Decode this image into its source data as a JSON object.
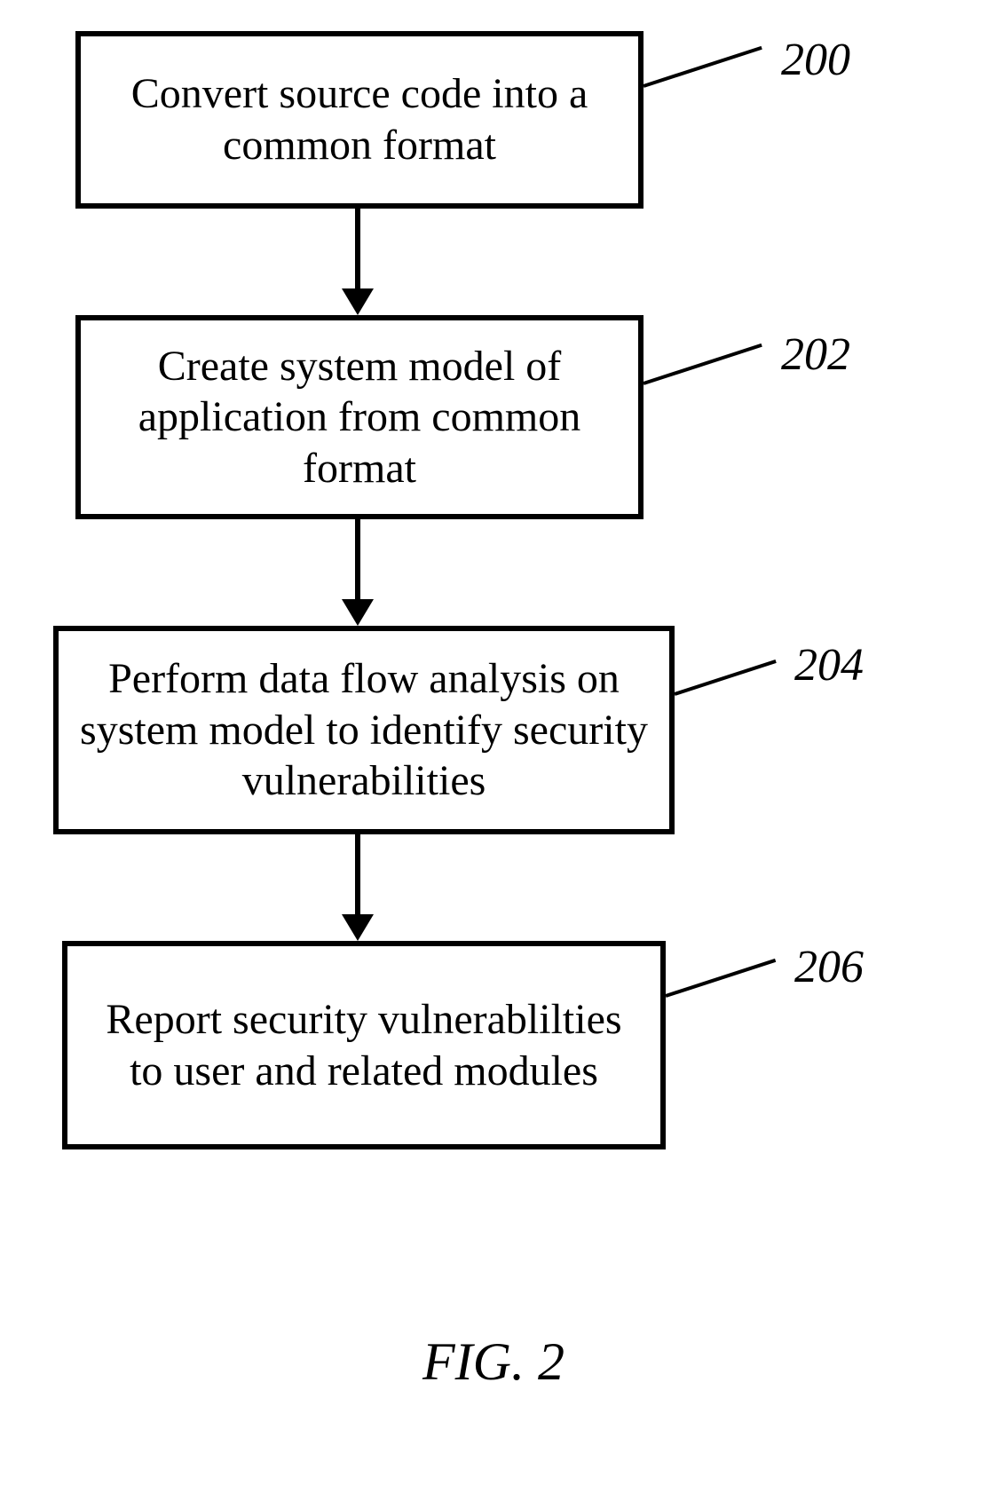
{
  "figure": {
    "caption": "FIG. 2",
    "steps": [
      {
        "ref": "200",
        "text": "Convert source code into a common format"
      },
      {
        "ref": "202",
        "text": "Create system model of application from common format"
      },
      {
        "ref": "204",
        "text": "Perform data flow analysis on system model to identify security vulnerabilities"
      },
      {
        "ref": "206",
        "text": "Report security vulnerablilties to user and related modules"
      }
    ]
  }
}
